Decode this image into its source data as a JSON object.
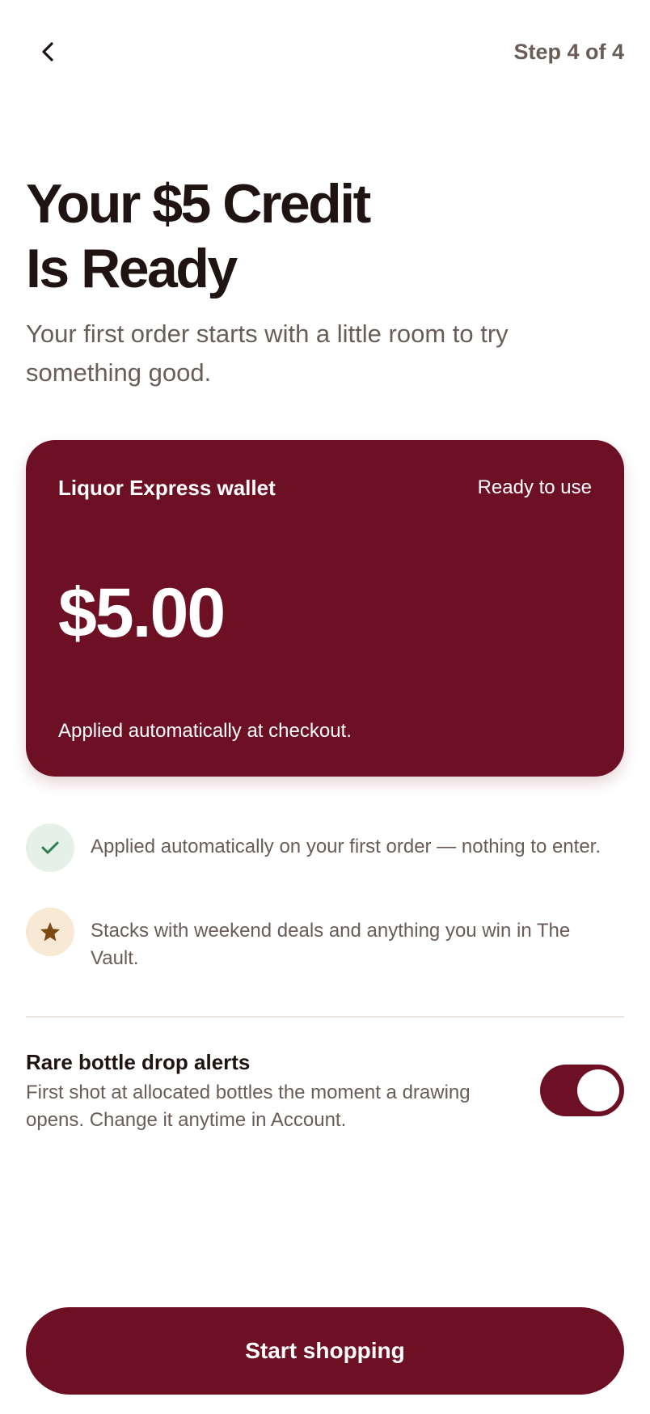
{
  "header": {
    "back_icon": "chevron-left-icon",
    "step": "Step 4 of 4"
  },
  "hero": {
    "title_line1": "Your $5 Credit",
    "title_line2": "Is Ready",
    "subtitle": "Your first order starts with a little room to try something good."
  },
  "wallet": {
    "name": "Liquor Express wallet",
    "status": "Ready to use",
    "amount": "$5.00",
    "note": "Applied automatically at checkout."
  },
  "benefits": [
    {
      "icon": "check-icon",
      "text": "Applied automatically on your first order — nothing to enter."
    },
    {
      "icon": "star-icon",
      "text": "Stacks with weekend deals and anything you win in The Vault."
    }
  ],
  "alerts": {
    "title": "Rare bottle drop alerts",
    "description": "First shot at allocated bottles the moment a drawing opens. Change it anytime in Account.",
    "toggle_on": true
  },
  "cta": {
    "label": "Start shopping"
  },
  "colors": {
    "brand": "#6e1024",
    "text_primary": "#1f1412",
    "text_secondary": "#6a5d58",
    "check_green": "#2e7d4f",
    "star_gold": "#7a4a12"
  }
}
